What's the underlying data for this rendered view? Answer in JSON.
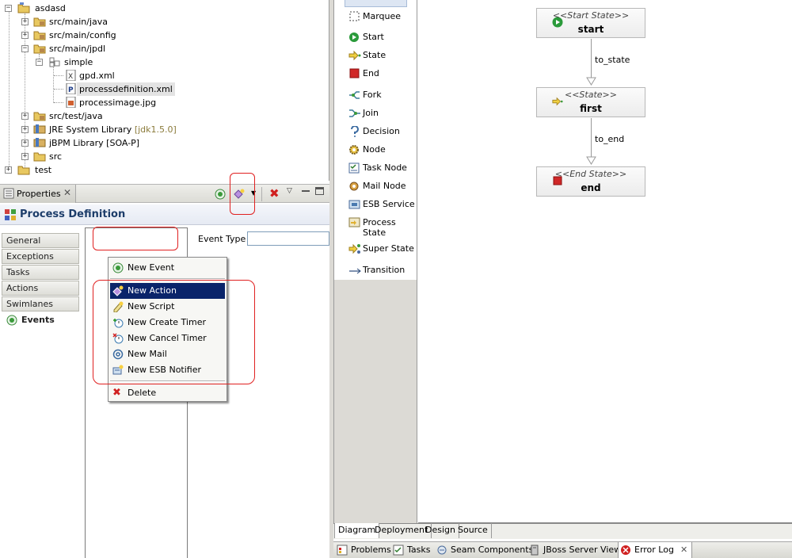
{
  "tree": {
    "items": [
      {
        "label": "asdasd",
        "decoration": ""
      },
      {
        "label": "src/main/java",
        "decoration": ""
      },
      {
        "label": "src/main/config",
        "decoration": ""
      },
      {
        "label": "src/main/jpdl",
        "decoration": ""
      },
      {
        "label": "simple",
        "decoration": ""
      },
      {
        "label": "gpd.xml",
        "decoration": ""
      },
      {
        "label": "processdefinition.xml",
        "decoration": ""
      },
      {
        "label": "processimage.jpg",
        "decoration": ""
      },
      {
        "label": "src/test/java",
        "decoration": ""
      },
      {
        "label": "JRE System Library",
        "decoration": "[jdk1.5.0]"
      },
      {
        "label": "jBPM Library [SOA-P]",
        "decoration": ""
      },
      {
        "label": "src",
        "decoration": ""
      },
      {
        "label": "test",
        "decoration": ""
      }
    ]
  },
  "properties": {
    "tab_label": "Properties",
    "title": "Process Definition",
    "side_tabs": [
      "General",
      "Exceptions",
      "Tasks",
      "Actions",
      "Swimlanes",
      "Events"
    ],
    "active_side_tab": "Events",
    "event_type_label": "Event Type",
    "event_type_value": ""
  },
  "context_menu": {
    "items": [
      "New Event",
      "New Action",
      "New Script",
      "New Create Timer",
      "New Cancel Timer",
      "New Mail",
      "New ESB Notifier",
      "Delete"
    ],
    "highlighted": "New Action"
  },
  "palette": {
    "items": [
      "Marquee",
      "Start",
      "State",
      "End",
      "Fork",
      "Join",
      "Decision",
      "Node",
      "Task Node",
      "Mail Node",
      "ESB Service",
      "Process State",
      "Super State",
      "Transition"
    ]
  },
  "diagram": {
    "nodes": [
      {
        "stereotype": "<<Start State>>",
        "name": "start"
      },
      {
        "stereotype": "<<State>>",
        "name": "first"
      },
      {
        "stereotype": "<<End State>>",
        "name": "end"
      }
    ],
    "transitions": [
      "to_state",
      "to_end"
    ]
  },
  "editor_tabs": [
    "Diagram",
    "Deployment",
    "Design",
    "Source"
  ],
  "active_editor_tab": "Diagram",
  "view_tabs": [
    "Problems",
    "Tasks",
    "Seam Components",
    "JBoss Server View",
    "Error Log"
  ],
  "active_view_tab": "Error Log",
  "colors": {
    "title_text": "#1d3d6a",
    "menu_highlight": "#0a246a",
    "annotation_red": "#e02020",
    "node_fill": "#ececec"
  }
}
